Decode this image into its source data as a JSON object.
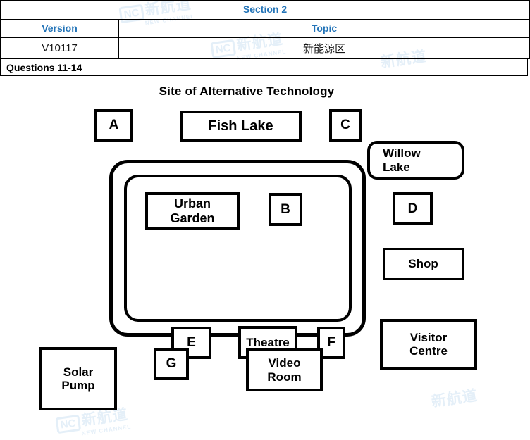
{
  "header": {
    "section_title": "Section 2",
    "col_version_label": "Version",
    "col_topic_label": "Topic",
    "version_value": "V10117",
    "topic_value": "新能源区",
    "questions_label": "Questions 11-14",
    "accent_color": "#2374b8"
  },
  "watermark": {
    "badge": "NC",
    "cn": "新航道",
    "en": "NEW CHANNEL"
  },
  "map": {
    "title": "Site of Alternative Technology",
    "boxes": [
      {
        "id": "a",
        "label": "A"
      },
      {
        "id": "fish-lake",
        "label": "Fish Lake"
      },
      {
        "id": "c",
        "label": "C"
      },
      {
        "id": "willow-lake",
        "label": "Willow\nLake"
      },
      {
        "id": "urban-garden",
        "label": "Urban\nGarden"
      },
      {
        "id": "b",
        "label": "B"
      },
      {
        "id": "d",
        "label": "D"
      },
      {
        "id": "e",
        "label": "E"
      },
      {
        "id": "theatre",
        "label": "Theatre"
      },
      {
        "id": "f",
        "label": "F"
      },
      {
        "id": "shop",
        "label": "Shop"
      },
      {
        "id": "visitor-centre",
        "label": "Visitor\nCentre"
      },
      {
        "id": "solar-pump",
        "label": "Solar\nPump"
      },
      {
        "id": "g",
        "label": "G"
      },
      {
        "id": "video-room",
        "label": "Video\nRoom"
      }
    ]
  }
}
